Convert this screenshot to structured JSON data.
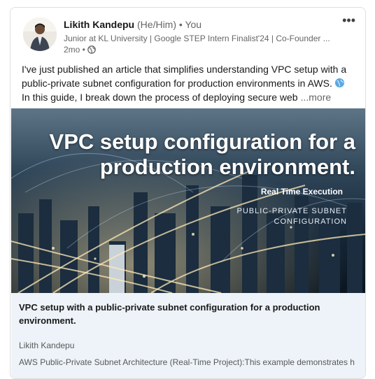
{
  "post": {
    "author_name": "Likith Kandepu",
    "pronouns": "(He/Him)",
    "separator": "•",
    "connection": "You",
    "headline": "Junior at KL University | Google STEP Intern Finalist'24 | Co-Founder ...",
    "time_ago": "2mo •",
    "visibility_icon": "globe-icon",
    "more_icon": "•••",
    "body_line1": "I've just published an article that simplifies understanding VPC setup with a",
    "body_line2": "public-private subnet configuration for production environments in AWS.",
    "body_line3": "In this guide, I break down the process of deploying secure web",
    "see_more": "...more"
  },
  "article": {
    "image_title": "VPC setup configuration for a production environment.",
    "image_subtitle": "Real Time Execution",
    "image_tagline": "PUBLIC-PRIVATE SUBNET CONFIGURATION",
    "title": "VPC setup with a public-private subnet configuration for a production environment.",
    "author": "Likith Kandepu",
    "description": "AWS Public-Private Subnet Architecture (Real-Time Project):This example demonstrates h..."
  },
  "colors": {
    "text_primary": "#191919",
    "text_secondary": "#666666",
    "footer_bg": "#edf3f8",
    "card_border": "#e0dfdc"
  }
}
